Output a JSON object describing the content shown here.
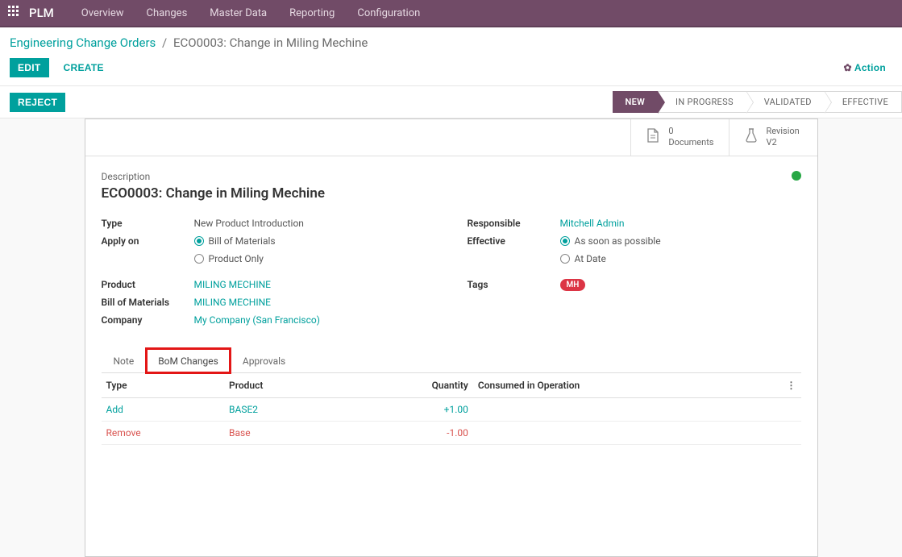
{
  "brand": "PLM",
  "nav": [
    "Overview",
    "Changes",
    "Master Data",
    "Reporting",
    "Configuration"
  ],
  "breadcrumb": {
    "root": "Engineering Change Orders",
    "current": "ECO0003: Change in Miling Mechine"
  },
  "toolbar": {
    "edit": "EDIT",
    "create": "CREATE",
    "action": "Action",
    "reject": "REJECT"
  },
  "stages": [
    "NEW",
    "IN PROGRESS",
    "VALIDATED",
    "EFFECTIVE"
  ],
  "active_stage": 0,
  "stats": {
    "docs_count": "0",
    "docs_label": "Documents",
    "rev_label": "Revision",
    "rev_val": "V2"
  },
  "description_label": "Description",
  "title": "ECO0003: Change in Miling Mechine",
  "labels": {
    "type": "Type",
    "apply_on": "Apply on",
    "product": "Product",
    "bom": "Bill of Materials",
    "company": "Company",
    "responsible": "Responsible",
    "effective": "Effective",
    "tags": "Tags"
  },
  "values": {
    "type": "New Product Introduction",
    "apply_bom": "Bill of Materials",
    "apply_product": "Product Only",
    "product": "MILING MECHINE",
    "bom": "MILING MECHINE",
    "company": "My Company (San Francisco)",
    "responsible": "Mitchell Admin",
    "eff_asap": "As soon as possible",
    "eff_date": "At Date",
    "tag": "MH"
  },
  "tabs": [
    "Note",
    "BoM Changes",
    "Approvals"
  ],
  "active_tab": 1,
  "table": {
    "headers": [
      "Type",
      "Product",
      "Quantity",
      "Consumed in Operation"
    ],
    "rows": [
      {
        "type": "Add",
        "type_class": "link-c",
        "product": "BASE2",
        "product_class": "link-c",
        "qty": "+1.00",
        "consumed": ""
      },
      {
        "type": "Remove",
        "type_class": "link-r",
        "product": "Base",
        "product_class": "link-r",
        "qty": "-1.00",
        "consumed": ""
      }
    ]
  }
}
